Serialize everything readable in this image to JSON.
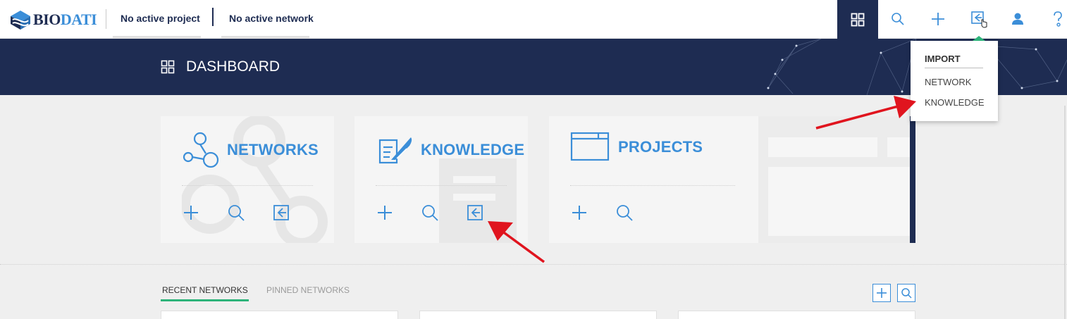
{
  "brand": {
    "part1": "BIO",
    "part2": "DATI"
  },
  "header": {
    "project": "No active project",
    "network": "No active network"
  },
  "banner": {
    "title": "DASHBOARD"
  },
  "cards": [
    {
      "title": "NETWORKS",
      "actions": [
        "add",
        "search",
        "import"
      ]
    },
    {
      "title": "KNOWLEDGE",
      "actions": [
        "add",
        "search",
        "import"
      ]
    },
    {
      "title": "PROJECTS",
      "actions": [
        "add",
        "search"
      ]
    }
  ],
  "dropdown": {
    "heading": "IMPORT",
    "items": [
      "NETWORK",
      "KNOWLEDGE"
    ]
  },
  "tabs": [
    {
      "label": "RECENT NETWORKS",
      "active": true
    },
    {
      "label": "PINNED NETWORKS",
      "active": false
    }
  ],
  "colors": {
    "navy": "#1e2c52",
    "blue": "#3b8ed8",
    "green": "#2db37a",
    "arrow": "#e0141e"
  },
  "icons": [
    "dashboard-icon",
    "search-icon",
    "plus-icon",
    "import-icon",
    "user-icon",
    "help-icon",
    "networks-icon",
    "knowledge-icon",
    "projects-icon"
  ]
}
